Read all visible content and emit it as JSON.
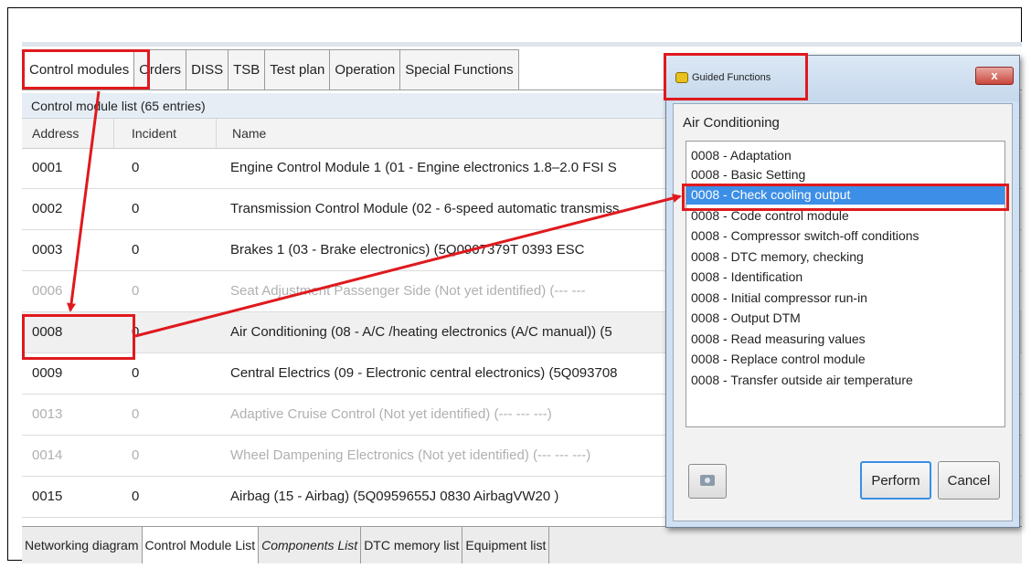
{
  "tabs": [
    "Control modules",
    "Orders",
    "DISS",
    "TSB",
    "Test plan",
    "Operation",
    "Special Functions"
  ],
  "list_title": "Control module list (65 entries)",
  "columns": {
    "address": "Address",
    "incident": "Incident",
    "name": "Name"
  },
  "rows": [
    {
      "address": "0001",
      "incident": "0",
      "name": "Engine Control Module 1 (01 - Engine electronics 1.8–2.0 FSI S"
    },
    {
      "address": "0002",
      "incident": "0",
      "name": "Transmission Control Module (02 - 6-speed automatic transmiss"
    },
    {
      "address": "0003",
      "incident": "0",
      "name": "Brakes 1 (03 - Brake electronics) (5Q0907379T   0393   ESC"
    },
    {
      "address": "0006",
      "incident": "0",
      "name": "Seat Adjustment Passenger Side (Not yet identified) (---  ---"
    },
    {
      "address": "0008",
      "incident": "0",
      "name": "Air Conditioning (08 - A/C /heating electronics (A/C manual)) (5"
    },
    {
      "address": "0009",
      "incident": "0",
      "name": "Central Electrics (09 - Electronic central electronics) (5Q093708"
    },
    {
      "address": "0013",
      "incident": "0",
      "name": "Adaptive Cruise Control (Not yet identified) (---  ---  ---)"
    },
    {
      "address": "0014",
      "incident": "0",
      "name": "Wheel Dampening Electronics (Not yet identified) (---  ---  ---)"
    },
    {
      "address": "0015",
      "incident": "0",
      "name": "Airbag (15 - Airbag) (5Q0959655J    0830   AirbagVW20   )"
    }
  ],
  "bottom_tabs": [
    "Networking diagram",
    "Control Module List",
    "Components List",
    "DTC memory list",
    "Equipment list"
  ],
  "dialog": {
    "title": "Guided Functions",
    "close_label": "x",
    "heading": "Air Conditioning",
    "options": [
      "0008 - Adaptation",
      "0008 - Basic Setting",
      "0008 - Check cooling output",
      "0008 - Code control module",
      "0008 - Compressor switch-off conditions",
      "0008 - DTC memory, checking",
      "0008 - Identification",
      "0008 - Initial compressor run-in",
      "0008 - Output DTM",
      "0008 - Read measuring values",
      "0008 - Replace control module",
      "0008 - Transfer outside air temperature"
    ],
    "selected_option": "0008 - Check cooling output",
    "perform_label": "Perform",
    "cancel_label": "Cancel"
  },
  "colors": {
    "highlight": "#e0191e",
    "selection": "#3d8ee6",
    "dialog_bg": "#cfe0f2"
  }
}
